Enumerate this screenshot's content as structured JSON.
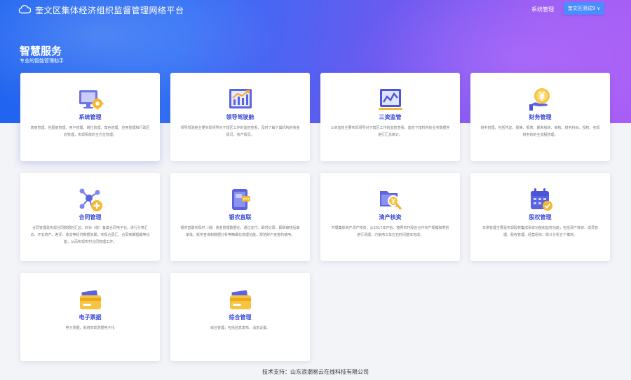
{
  "header": {
    "title": "奎文区集体经济组织监督管理网络平台",
    "nav_system": "系统管理",
    "user_label": "奎文区测试9",
    "user_caret": "∨"
  },
  "section": {
    "title": "智慧服务",
    "subtitle": "专业的智能管理助手"
  },
  "cards": [
    {
      "title": "系统管理",
      "desc": "表册管理、包图册管理、用户管理、岗位管理、角色管理、应用管理和行政区划管理，实现系统的全方位管理。",
      "icon": "monitor-gear-icon"
    },
    {
      "title": "领导驾驶舱",
      "desc": "领导驾驶舱主要实现领导对于辖区工作的监管查看，及时了解下属机构的资金情况、资产情况。",
      "icon": "bar-chart-icon"
    },
    {
      "title": "三资监管",
      "desc": "三资监管主要实现领导对于辖区工作的监管查看，监管下辖机构的业务数据并进行汇总统计。",
      "icon": "line-chart-icon"
    },
    {
      "title": "财务管理",
      "desc": "财务管理，包括凭证、账簿、报表、期末结转、审核、财务科目、授权、实现财务的的全流程管理。",
      "icon": "yuan-coin-icon"
    },
    {
      "title": "合同管理",
      "desc": "合同管理是实现合同数据的汇总、匹对（统）备案合同电子化，进行分类汇总、开支统产、差评、收支等经济数据关联，实现合同汇、合同到期提醒等功能，从而实现农村合同管理工作。",
      "icon": "network-plus-icon"
    },
    {
      "title": "银农直联",
      "desc": "银农直联实现村（组）资金管理数据化、通过支付、即时记录、即刷审核后审单批、账务查询和数据分析等精细化管理功能，规范财户资金的使用。",
      "icon": "bank-card-icon"
    },
    {
      "title": "清产核资",
      "desc": "开展集体资产清产核资，从2017年开始、按照农村股份合作资产规模和类别进行清理，力争用三年左右时间基本完成。",
      "icon": "folder-search-icon"
    },
    {
      "title": "股权管理",
      "desc": "日常管理主要是实现股权集成系统功能和监管功能，包括清产核资、成员管理、股权管理、经营组织、统计分析五个模块。",
      "icon": "calendar-check-icon"
    },
    {
      "title": "电子票据",
      "desc": "电子票据，系统实现票据电子化",
      "icon": "wallet-card-icon"
    },
    {
      "title": "综合管理",
      "desc": "综合管理，包括信息发布、消息设置。",
      "icon": "wallet-card-icon"
    }
  ],
  "footer": {
    "text": "技术支持：山东浪潮易云在线科技有限公司"
  },
  "colors": {
    "accent": "#3a4bd8",
    "button": "#4a8dff",
    "hero_start": "#1e63f0",
    "hero_end": "#a85ef5"
  }
}
